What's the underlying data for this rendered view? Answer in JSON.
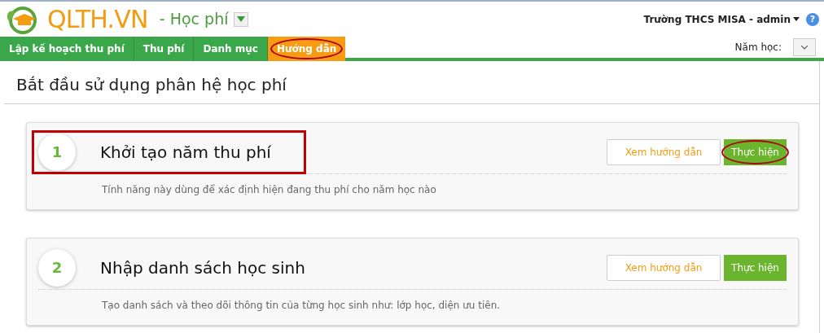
{
  "header": {
    "logo_text": "QLTH.VN",
    "module": "- Học phí",
    "account": "Trường THCS MISA - admin",
    "help": "?"
  },
  "tabs": [
    {
      "label": "Lập kế hoạch thu phí",
      "selected": false,
      "circled": false
    },
    {
      "label": "Thu phí",
      "selected": false,
      "circled": false
    },
    {
      "label": "Danh mục",
      "selected": false,
      "circled": false
    },
    {
      "label": "Hướng dẫn",
      "selected": true,
      "circled": true
    }
  ],
  "year_filter": {
    "label": "Năm học:"
  },
  "page_title": "Bắt đầu sử dụng phân hệ học phí",
  "steps": [
    {
      "number": "1",
      "title": "Khởi tạo năm thu phí",
      "description": "Tính năng này dùng để xác định hiện đang thu phí cho năm học nào",
      "boxed": true,
      "guide_button": "Xem hướng dẫn",
      "run_button": "Thực hiện",
      "run_circled": true
    },
    {
      "number": "2",
      "title": "Nhập danh sách học sinh",
      "description": "Tạo danh sách và theo dõi thông tin của từng học sinh như: lớp học, diện ưu tiên.",
      "boxed": false,
      "guide_button": "Xem hướng dẫn",
      "run_button": "Thực hiện",
      "run_circled": false
    }
  ]
}
